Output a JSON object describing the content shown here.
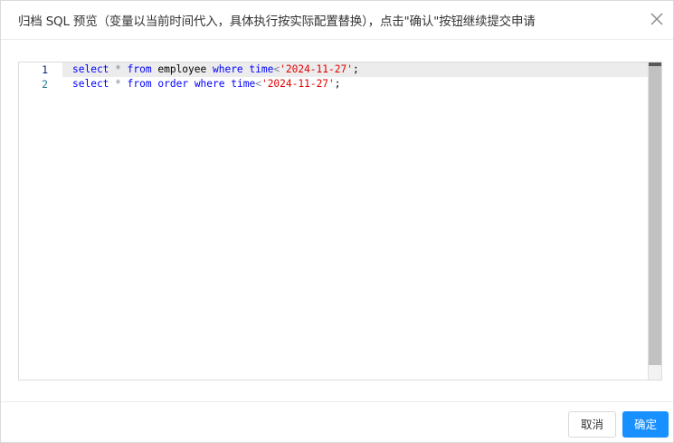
{
  "dialog": {
    "title": "归档 SQL 预览（变量以当前时间代入，具体执行按实际配置替换），点击\"确认\"按钮继续提交申请",
    "close_icon": "close-icon"
  },
  "editor": {
    "language": "sql",
    "lines": [
      {
        "number": "1",
        "tokens": [
          {
            "text": "select",
            "type": "keyword"
          },
          {
            "text": " ",
            "type": "plain"
          },
          {
            "text": "*",
            "type": "operator"
          },
          {
            "text": " ",
            "type": "plain"
          },
          {
            "text": "from",
            "type": "keyword"
          },
          {
            "text": " employee ",
            "type": "plain"
          },
          {
            "text": "where",
            "type": "keyword"
          },
          {
            "text": " ",
            "type": "plain"
          },
          {
            "text": "time",
            "type": "keyword"
          },
          {
            "text": "<",
            "type": "operator"
          },
          {
            "text": "'2024-11-27'",
            "type": "string"
          },
          {
            "text": ";",
            "type": "plain"
          }
        ]
      },
      {
        "number": "2",
        "tokens": [
          {
            "text": "select",
            "type": "keyword"
          },
          {
            "text": " ",
            "type": "plain"
          },
          {
            "text": "*",
            "type": "operator"
          },
          {
            "text": " ",
            "type": "plain"
          },
          {
            "text": "from",
            "type": "keyword"
          },
          {
            "text": " ",
            "type": "plain"
          },
          {
            "text": "order",
            "type": "keyword"
          },
          {
            "text": " ",
            "type": "plain"
          },
          {
            "text": "where",
            "type": "keyword"
          },
          {
            "text": " ",
            "type": "plain"
          },
          {
            "text": "time",
            "type": "keyword"
          },
          {
            "text": "<",
            "type": "operator"
          },
          {
            "text": "'2024-11-27'",
            "type": "string"
          },
          {
            "text": ";",
            "type": "plain"
          }
        ]
      }
    ]
  },
  "footer": {
    "cancel_label": "取消",
    "ok_label": "确定"
  },
  "colors": {
    "primary": "#1890ff",
    "keyword": "#0000ff",
    "string": "#e00000",
    "line_number": "#237893",
    "current_line_bg": "#ececec"
  }
}
